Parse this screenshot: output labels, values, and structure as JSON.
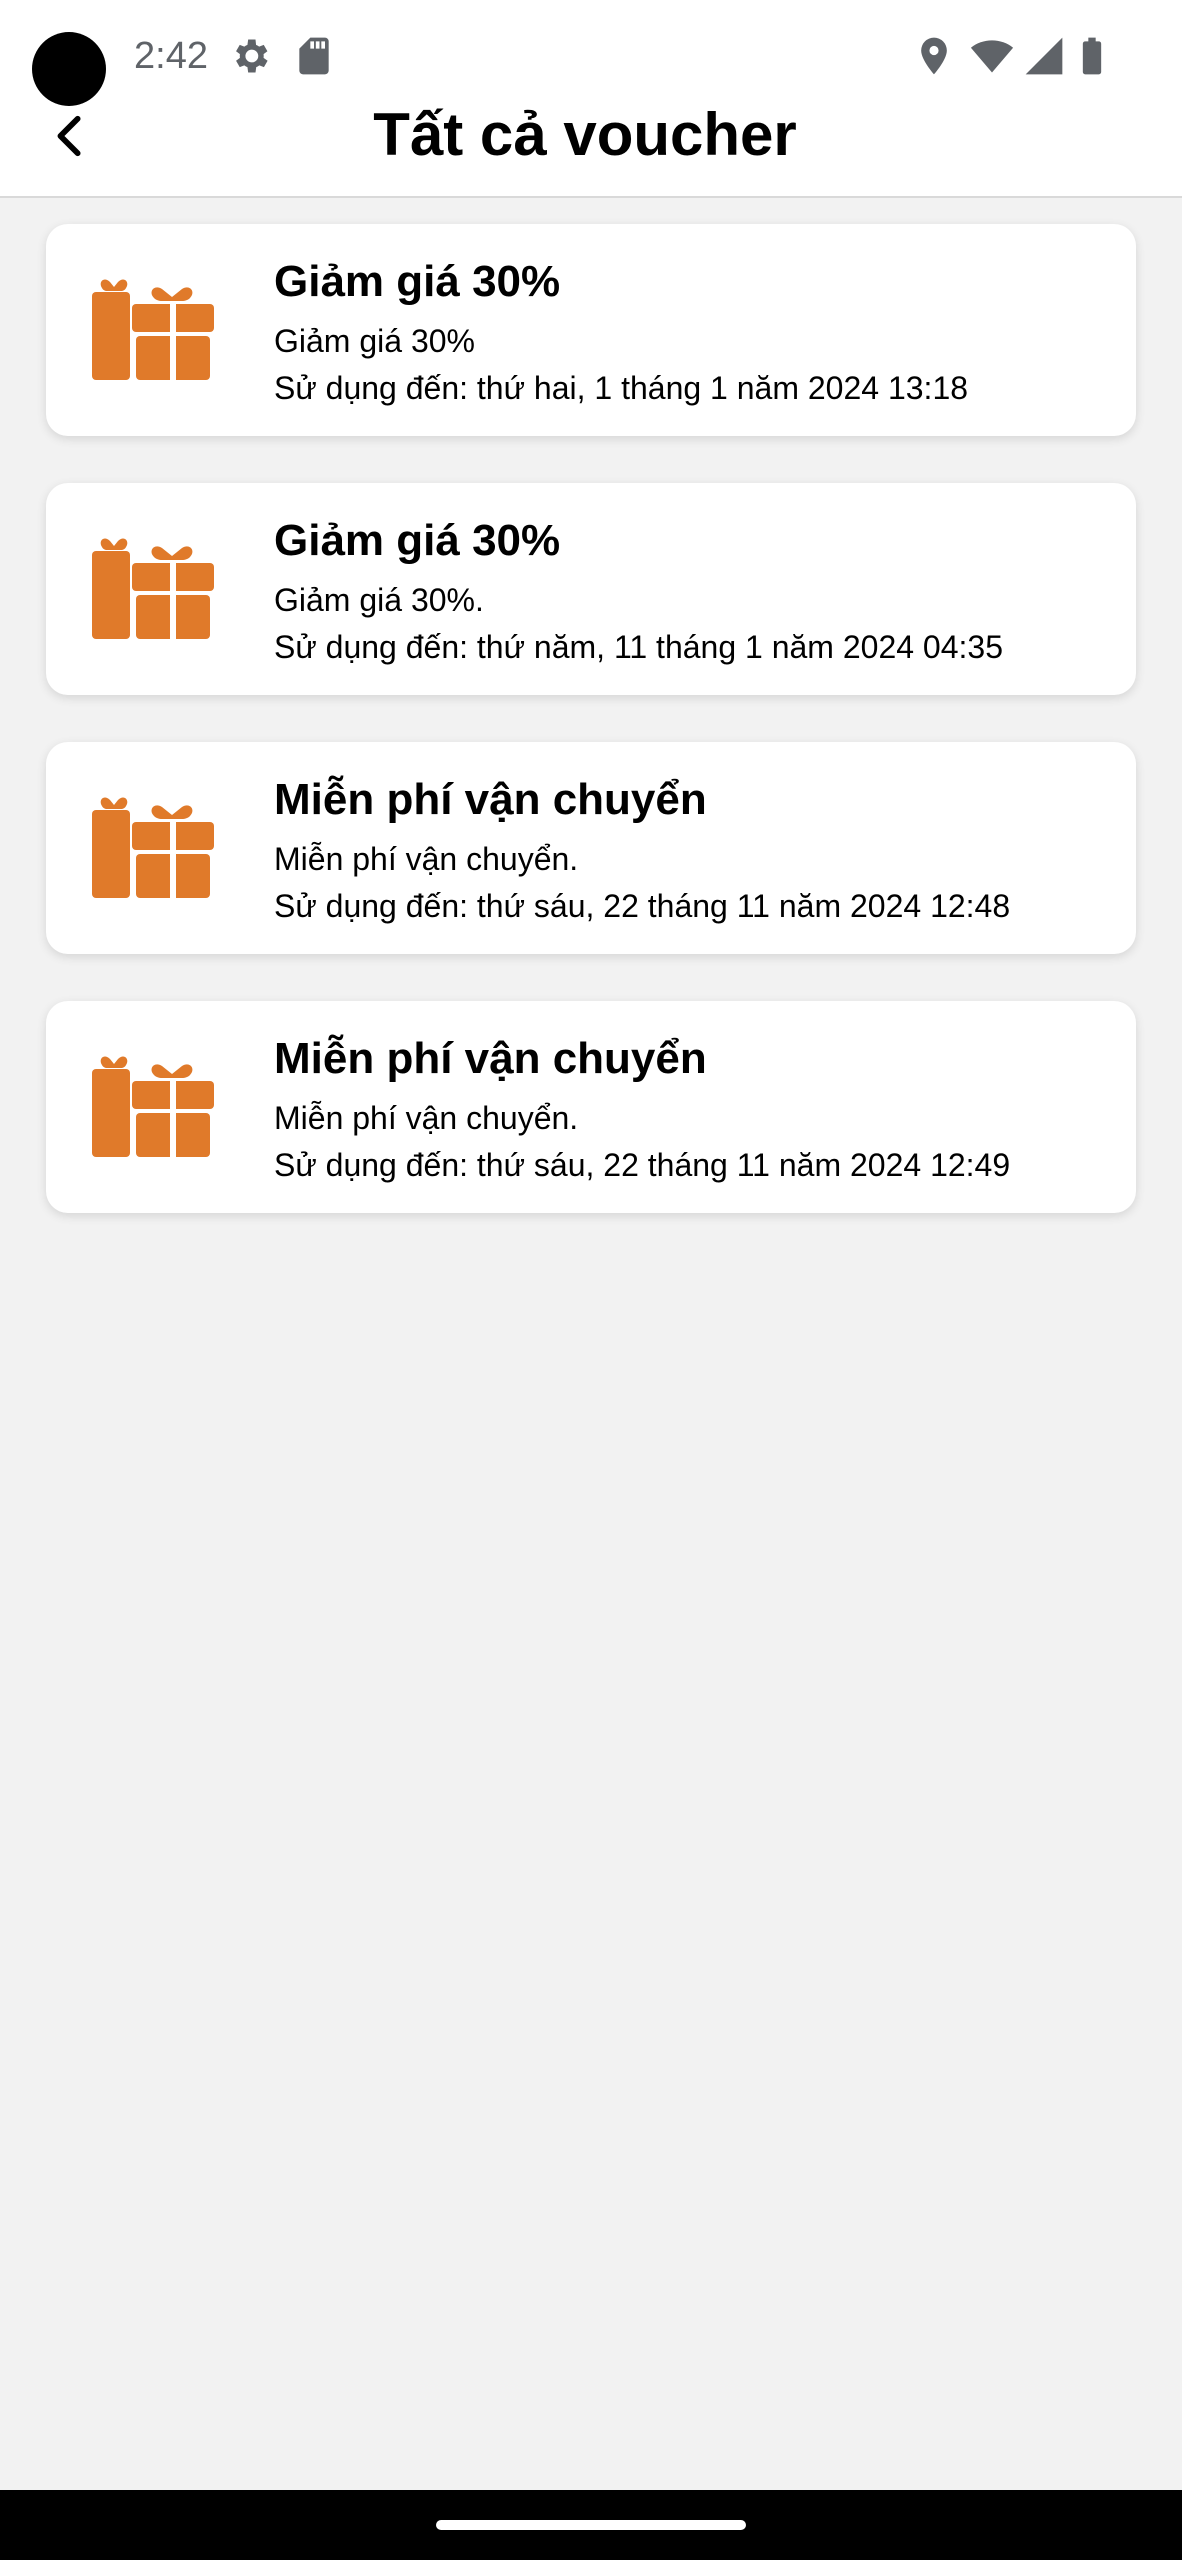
{
  "status_bar": {
    "time": "2:42",
    "icons": [
      "gear-icon",
      "sd-card-icon",
      "location-icon",
      "wifi-icon",
      "signal-icon",
      "battery-icon"
    ]
  },
  "header": {
    "title": "Tất cả voucher",
    "back_icon": "chevron-left-icon"
  },
  "colors": {
    "accent": "#e07a2a",
    "background": "#f2f2f2",
    "card": "#ffffff"
  },
  "vouchers": [
    {
      "title": "Giảm giá 30%",
      "description": "Giảm giá 30%",
      "expiry": "Sử dụng đến: thứ hai, 1 tháng 1 năm 2024 13:18",
      "icon": "gift-icon"
    },
    {
      "title": "Giảm giá 30%",
      "description": "Giảm giá 30%.",
      "expiry": "Sử dụng đến: thứ năm, 11 tháng 1 năm 2024 04:35",
      "icon": "gift-icon"
    },
    {
      "title": "Miễn phí vận chuyển",
      "description": "Miễn phí vận chuyển.",
      "expiry": "Sử dụng đến: thứ sáu, 22 tháng 11 năm 2024 12:48",
      "icon": "gift-icon"
    },
    {
      "title": "Miễn phí vận chuyển",
      "description": "Miễn phí vận chuyển.",
      "expiry": "Sử dụng đến: thứ sáu, 22 tháng 11 năm 2024 12:49",
      "icon": "gift-icon"
    }
  ]
}
